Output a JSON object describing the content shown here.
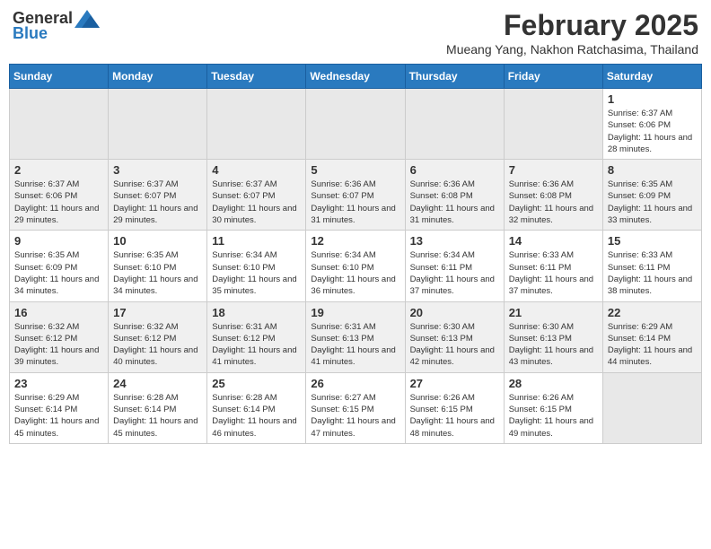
{
  "header": {
    "logo": {
      "text_general": "General",
      "text_blue": "Blue"
    },
    "month": "February 2025",
    "location": "Mueang Yang, Nakhon Ratchasima, Thailand"
  },
  "weekdays": [
    "Sunday",
    "Monday",
    "Tuesday",
    "Wednesday",
    "Thursday",
    "Friday",
    "Saturday"
  ],
  "weeks": [
    {
      "days": [
        {
          "num": "",
          "empty": true
        },
        {
          "num": "",
          "empty": true
        },
        {
          "num": "",
          "empty": true
        },
        {
          "num": "",
          "empty": true
        },
        {
          "num": "",
          "empty": true
        },
        {
          "num": "",
          "empty": true
        },
        {
          "num": "1",
          "sunrise": "6:37 AM",
          "sunset": "6:06 PM",
          "daylight": "11 hours and 28 minutes."
        }
      ]
    },
    {
      "days": [
        {
          "num": "2",
          "sunrise": "6:37 AM",
          "sunset": "6:06 PM",
          "daylight": "11 hours and 29 minutes."
        },
        {
          "num": "3",
          "sunrise": "6:37 AM",
          "sunset": "6:07 PM",
          "daylight": "11 hours and 29 minutes."
        },
        {
          "num": "4",
          "sunrise": "6:37 AM",
          "sunset": "6:07 PM",
          "daylight": "11 hours and 30 minutes."
        },
        {
          "num": "5",
          "sunrise": "6:36 AM",
          "sunset": "6:07 PM",
          "daylight": "11 hours and 31 minutes."
        },
        {
          "num": "6",
          "sunrise": "6:36 AM",
          "sunset": "6:08 PM",
          "daylight": "11 hours and 31 minutes."
        },
        {
          "num": "7",
          "sunrise": "6:36 AM",
          "sunset": "6:08 PM",
          "daylight": "11 hours and 32 minutes."
        },
        {
          "num": "8",
          "sunrise": "6:35 AM",
          "sunset": "6:09 PM",
          "daylight": "11 hours and 33 minutes."
        }
      ]
    },
    {
      "days": [
        {
          "num": "9",
          "sunrise": "6:35 AM",
          "sunset": "6:09 PM",
          "daylight": "11 hours and 34 minutes."
        },
        {
          "num": "10",
          "sunrise": "6:35 AM",
          "sunset": "6:10 PM",
          "daylight": "11 hours and 34 minutes."
        },
        {
          "num": "11",
          "sunrise": "6:34 AM",
          "sunset": "6:10 PM",
          "daylight": "11 hours and 35 minutes."
        },
        {
          "num": "12",
          "sunrise": "6:34 AM",
          "sunset": "6:10 PM",
          "daylight": "11 hours and 36 minutes."
        },
        {
          "num": "13",
          "sunrise": "6:34 AM",
          "sunset": "6:11 PM",
          "daylight": "11 hours and 37 minutes."
        },
        {
          "num": "14",
          "sunrise": "6:33 AM",
          "sunset": "6:11 PM",
          "daylight": "11 hours and 37 minutes."
        },
        {
          "num": "15",
          "sunrise": "6:33 AM",
          "sunset": "6:11 PM",
          "daylight": "11 hours and 38 minutes."
        }
      ]
    },
    {
      "days": [
        {
          "num": "16",
          "sunrise": "6:32 AM",
          "sunset": "6:12 PM",
          "daylight": "11 hours and 39 minutes."
        },
        {
          "num": "17",
          "sunrise": "6:32 AM",
          "sunset": "6:12 PM",
          "daylight": "11 hours and 40 minutes."
        },
        {
          "num": "18",
          "sunrise": "6:31 AM",
          "sunset": "6:12 PM",
          "daylight": "11 hours and 41 minutes."
        },
        {
          "num": "19",
          "sunrise": "6:31 AM",
          "sunset": "6:13 PM",
          "daylight": "11 hours and 41 minutes."
        },
        {
          "num": "20",
          "sunrise": "6:30 AM",
          "sunset": "6:13 PM",
          "daylight": "11 hours and 42 minutes."
        },
        {
          "num": "21",
          "sunrise": "6:30 AM",
          "sunset": "6:13 PM",
          "daylight": "11 hours and 43 minutes."
        },
        {
          "num": "22",
          "sunrise": "6:29 AM",
          "sunset": "6:14 PM",
          "daylight": "11 hours and 44 minutes."
        }
      ]
    },
    {
      "days": [
        {
          "num": "23",
          "sunrise": "6:29 AM",
          "sunset": "6:14 PM",
          "daylight": "11 hours and 45 minutes."
        },
        {
          "num": "24",
          "sunrise": "6:28 AM",
          "sunset": "6:14 PM",
          "daylight": "11 hours and 45 minutes."
        },
        {
          "num": "25",
          "sunrise": "6:28 AM",
          "sunset": "6:14 PM",
          "daylight": "11 hours and 46 minutes."
        },
        {
          "num": "26",
          "sunrise": "6:27 AM",
          "sunset": "6:15 PM",
          "daylight": "11 hours and 47 minutes."
        },
        {
          "num": "27",
          "sunrise": "6:26 AM",
          "sunset": "6:15 PM",
          "daylight": "11 hours and 48 minutes."
        },
        {
          "num": "28",
          "sunrise": "6:26 AM",
          "sunset": "6:15 PM",
          "daylight": "11 hours and 49 minutes."
        },
        {
          "num": "",
          "empty": true
        }
      ]
    }
  ]
}
